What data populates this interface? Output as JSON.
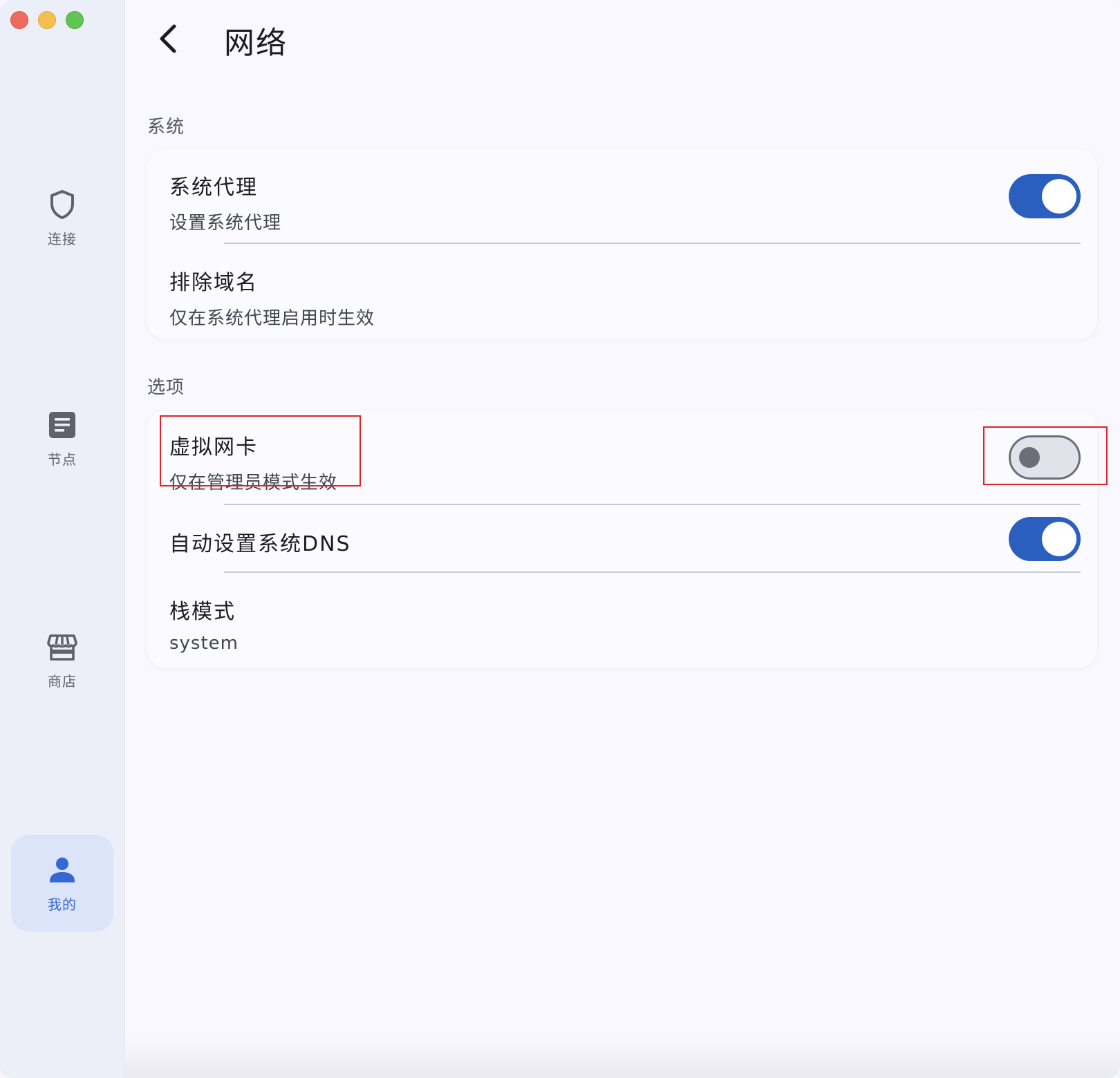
{
  "window": {
    "traffic_lights": [
      "close",
      "minimize",
      "zoom"
    ]
  },
  "sidebar": {
    "items": [
      {
        "label": "连接",
        "icon": "shield-icon",
        "active": false
      },
      {
        "label": "节点",
        "icon": "list-icon",
        "active": false
      },
      {
        "label": "商店",
        "icon": "store-icon",
        "active": false
      },
      {
        "label": "我的",
        "icon": "person-icon",
        "active": true
      }
    ]
  },
  "header": {
    "back_icon": "chevron-left-icon",
    "title": "网络"
  },
  "sections": [
    {
      "header": "系统",
      "rows": [
        {
          "title": "系统代理",
          "subtitle": "设置系统代理",
          "toggle": true
        },
        {
          "title": "排除域名",
          "subtitle": "仅在系统代理启用时生效"
        }
      ]
    },
    {
      "header": "选项",
      "rows": [
        {
          "title": "虚拟网卡",
          "subtitle": "仅在管理员模式生效",
          "toggle": false
        },
        {
          "title": "自动设置系统DNS",
          "toggle": true
        },
        {
          "title": "栈模式",
          "subtitle": "system"
        }
      ]
    }
  ],
  "colors": {
    "accent": "#2a5ebf",
    "active_nav_bg": "#dbe4f9",
    "active_nav_text": "#3568d4",
    "highlight": "#e0232b"
  }
}
